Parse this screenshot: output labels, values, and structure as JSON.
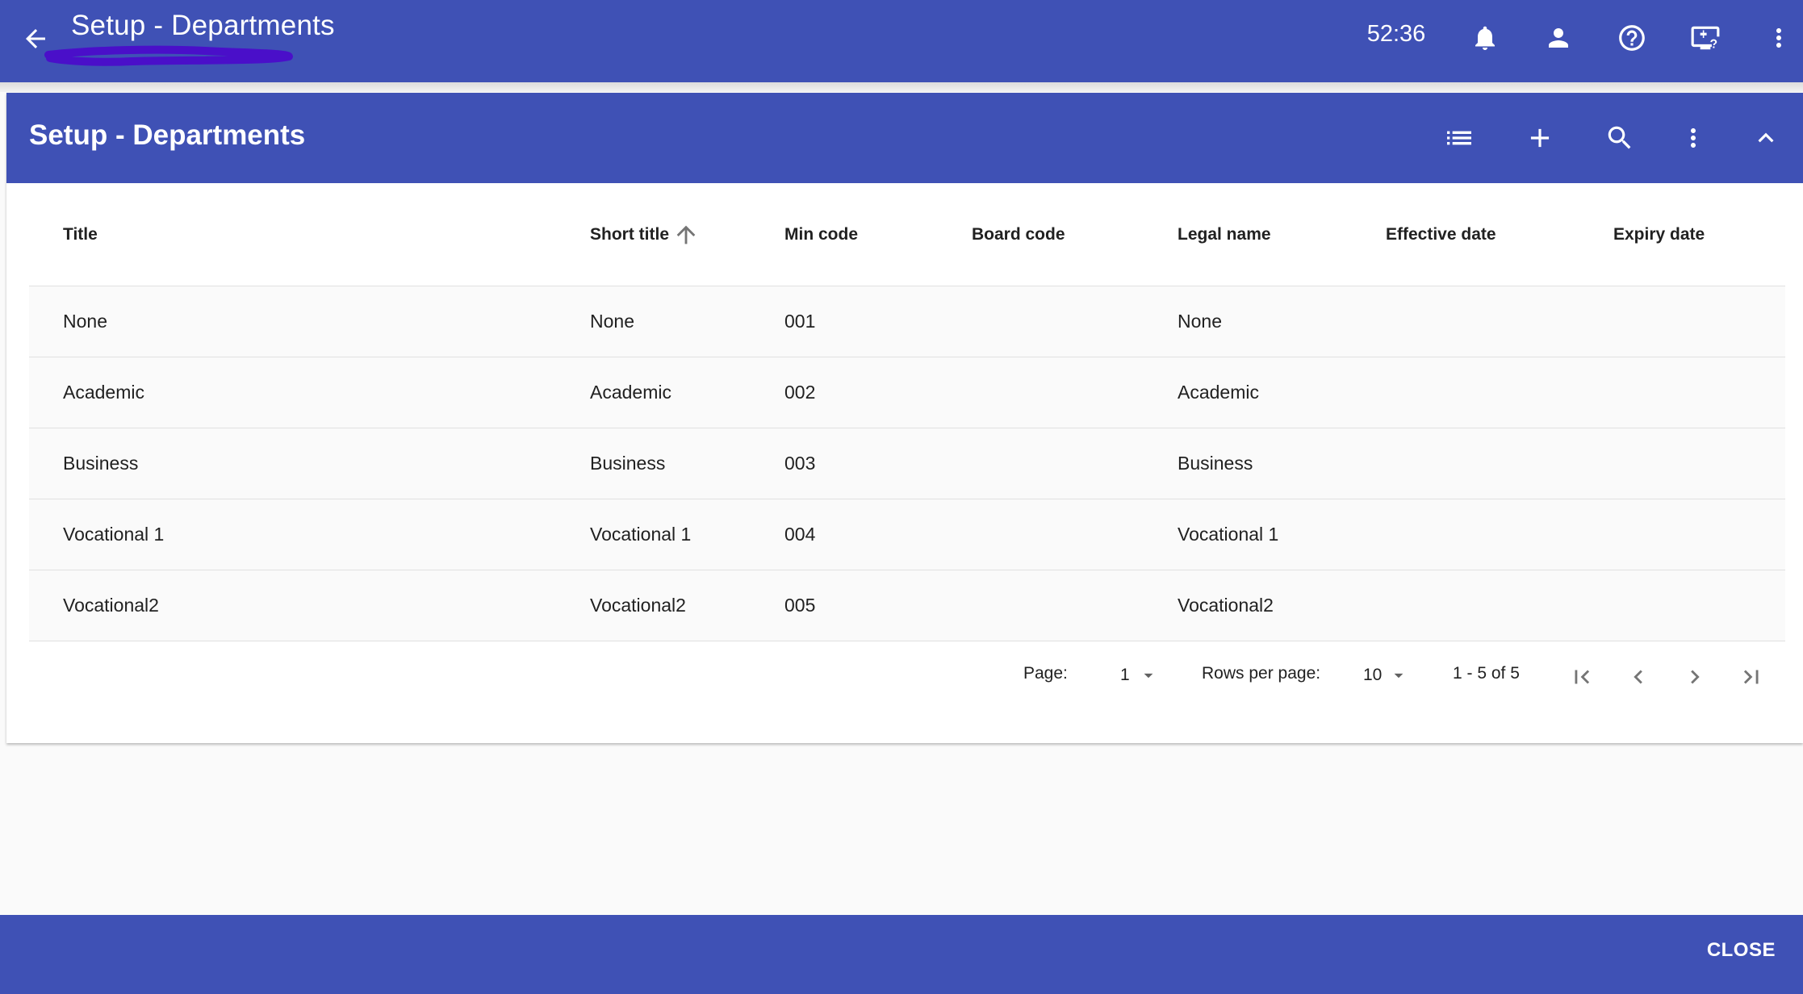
{
  "topbar": {
    "title": "Setup - Departments",
    "timer": "52:36",
    "icons": [
      "back-arrow-icon",
      "bell-icon",
      "person-icon",
      "help-icon",
      "monitor-help-icon",
      "more-vert-icon"
    ]
  },
  "panel": {
    "title": "Setup - Departments",
    "icons": [
      "list-icon",
      "add-icon",
      "search-icon",
      "more-vert-icon",
      "chevron-up-icon"
    ]
  },
  "table": {
    "columns": [
      "Title",
      "Short title",
      "Min code",
      "Board code",
      "Legal name",
      "Effective date",
      "Expiry date"
    ],
    "sort": {
      "column": "Short title",
      "direction": "ascending"
    },
    "rows": [
      {
        "title": "None",
        "short_title": "None",
        "min_code": "001",
        "board_code": "",
        "legal_name": "None",
        "effective_date": "",
        "expiry_date": ""
      },
      {
        "title": "Academic",
        "short_title": "Academic",
        "min_code": "002",
        "board_code": "",
        "legal_name": "Academic",
        "effective_date": "",
        "expiry_date": ""
      },
      {
        "title": "Business",
        "short_title": "Business",
        "min_code": "003",
        "board_code": "",
        "legal_name": "Business",
        "effective_date": "",
        "expiry_date": ""
      },
      {
        "title": "Vocational 1",
        "short_title": "Vocational 1",
        "min_code": "004",
        "board_code": "",
        "legal_name": "Vocational 1",
        "effective_date": "",
        "expiry_date": ""
      },
      {
        "title": "Vocational2",
        "short_title": "Vocational2",
        "min_code": "005",
        "board_code": "",
        "legal_name": "Vocational2",
        "effective_date": "",
        "expiry_date": ""
      }
    ]
  },
  "pagination": {
    "page_label": "Page:",
    "page_value": "1",
    "rows_label": "Rows per page:",
    "rows_value": "10",
    "range": "1 - 5 of 5"
  },
  "footer": {
    "close_label": "CLOSE"
  },
  "colors": {
    "primary": "#3f51b5",
    "scribble": "#4a0fc9"
  }
}
